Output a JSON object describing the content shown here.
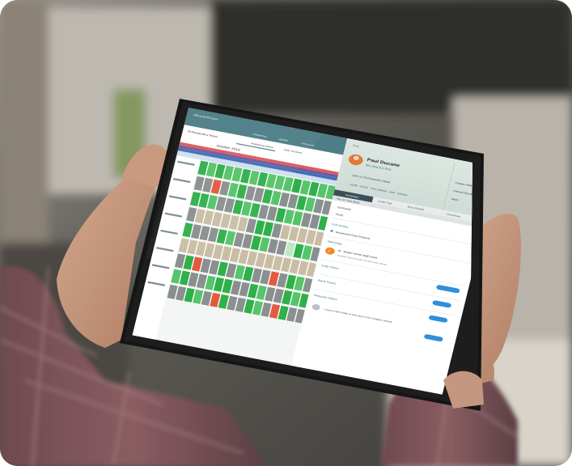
{
  "screen": {
    "app_name": "AllocateRoster",
    "tabs": [
      "Rostering",
      "Update",
      "Personal"
    ],
    "ward": "Orthopaedics Ward",
    "month": "October 2019",
    "rostering_label": "Rostering Admin",
    "user_label": "User Account",
    "week_banner": "14 October 2019"
  },
  "panel": {
    "duty_label": "Duty",
    "name": "Paul Ducane",
    "role": "RN (Band 6 RN)",
    "location": "Late (L) Orthopaedics Ward",
    "time": "13:00 - 20:00 · Thu 24mins · 6mi · 12mins",
    "actions": [
      "Create Additional Duty",
      "Cancel Demand",
      "More"
    ],
    "tabs": [
      "Summary",
      "Audit Trail",
      "Duty Details",
      "Timesheet"
    ],
    "date": "Thu 17 Oct 2019",
    "rows": [
      "Demand",
      "Duty"
    ],
    "activities_label": "Unit duties",
    "requested_label": "Requested Duty Request",
    "warnings_label": "Warnings",
    "warning_text": "M - Roster senior staff count",
    "warning_sub": "Duration Paul should not get roster above",
    "sections": [
      "Duty Notes",
      "Bank Notes",
      "Request Notes"
    ],
    "add_note": "Add Note",
    "request_text": "I need a late today to rota due to the hospital, please"
  }
}
